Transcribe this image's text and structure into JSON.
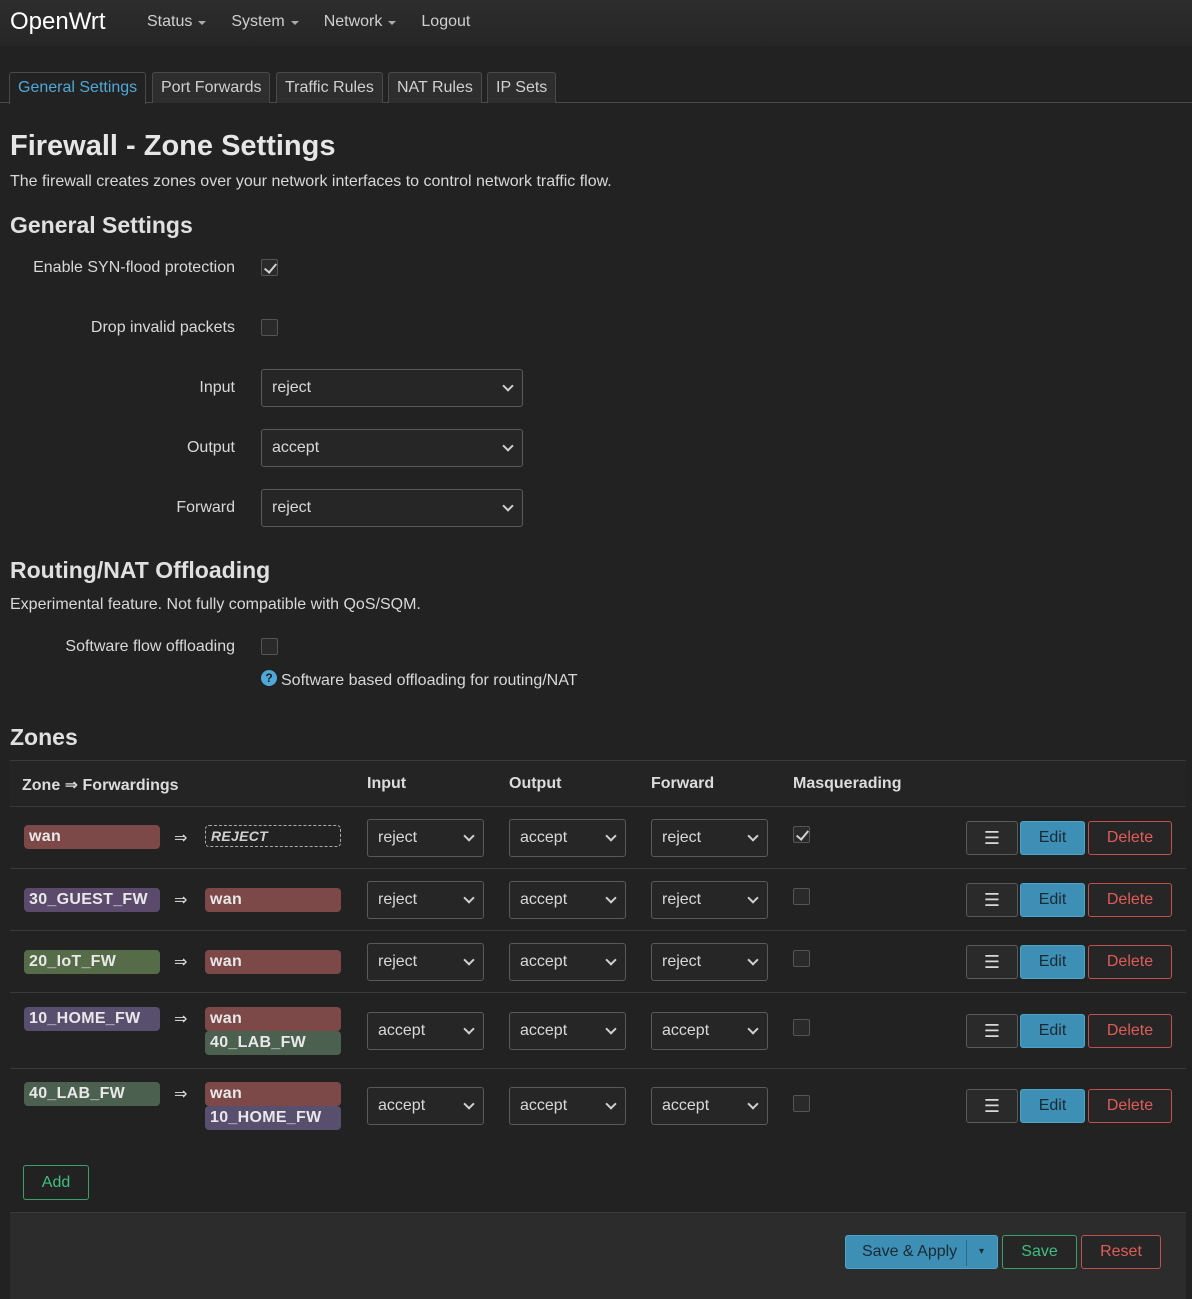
{
  "header": {
    "brand": "OpenWrt",
    "menu": [
      {
        "label": "Status"
      },
      {
        "label": "System"
      },
      {
        "label": "Network"
      },
      {
        "label": "Logout"
      }
    ]
  },
  "tabs": [
    {
      "label": "General Settings",
      "active": true
    },
    {
      "label": "Port Forwards"
    },
    {
      "label": "Traffic Rules"
    },
    {
      "label": "NAT Rules"
    },
    {
      "label": "IP Sets"
    }
  ],
  "page": {
    "title": "Firewall - Zone Settings",
    "description": "The firewall creates zones over your network interfaces to control network traffic flow."
  },
  "general": {
    "heading": "General Settings",
    "syn_flood_label": "Enable SYN-flood protection",
    "syn_flood_checked": true,
    "drop_invalid_label": "Drop invalid packets",
    "drop_invalid_checked": false,
    "input_label": "Input",
    "input_value": "reject",
    "output_label": "Output",
    "output_value": "accept",
    "forward_label": "Forward",
    "forward_value": "reject"
  },
  "offloading": {
    "heading": "Routing/NAT Offloading",
    "description": "Experimental feature. Not fully compatible with QoS/SQM.",
    "software_label": "Software flow offloading",
    "software_checked": false,
    "help_icon": "?",
    "help_text": "Software based offloading for routing/NAT"
  },
  "zones": {
    "heading": "Zones",
    "columns": {
      "zone": "Zone ⇒ Forwardings",
      "input": "Input",
      "output": "Output",
      "forward": "Forward",
      "masq": "Masquerading"
    },
    "arrow": "⇒",
    "menu_icon": "☰",
    "edit_label": "Edit",
    "delete_label": "Delete",
    "rows": [
      {
        "zone": "wan",
        "forwardings": [
          "REJECT"
        ],
        "input": "reject",
        "output": "accept",
        "forward": "reject",
        "masq": true
      },
      {
        "zone": "30_GUEST_FW",
        "forwardings": [
          "wan"
        ],
        "input": "reject",
        "output": "accept",
        "forward": "reject",
        "masq": false
      },
      {
        "zone": "20_IoT_FW",
        "forwardings": [
          "wan"
        ],
        "input": "reject",
        "output": "accept",
        "forward": "reject",
        "masq": false
      },
      {
        "zone": "10_HOME_FW",
        "forwardings": [
          "wan",
          "40_LAB_FW"
        ],
        "input": "accept",
        "output": "accept",
        "forward": "accept",
        "masq": false
      },
      {
        "zone": "40_LAB_FW",
        "forwardings": [
          "wan",
          "10_HOME_FW"
        ],
        "input": "accept",
        "output": "accept",
        "forward": "accept",
        "masq": false
      }
    ],
    "add_label": "Add"
  },
  "footer": {
    "save_apply_label": "Save & Apply",
    "dropdown_icon": "▾",
    "save_label": "Save",
    "reset_label": "Reset"
  },
  "colors": {
    "accent": "#4fa8d8",
    "success": "#3fbf7f",
    "danger": "#e05c58"
  }
}
